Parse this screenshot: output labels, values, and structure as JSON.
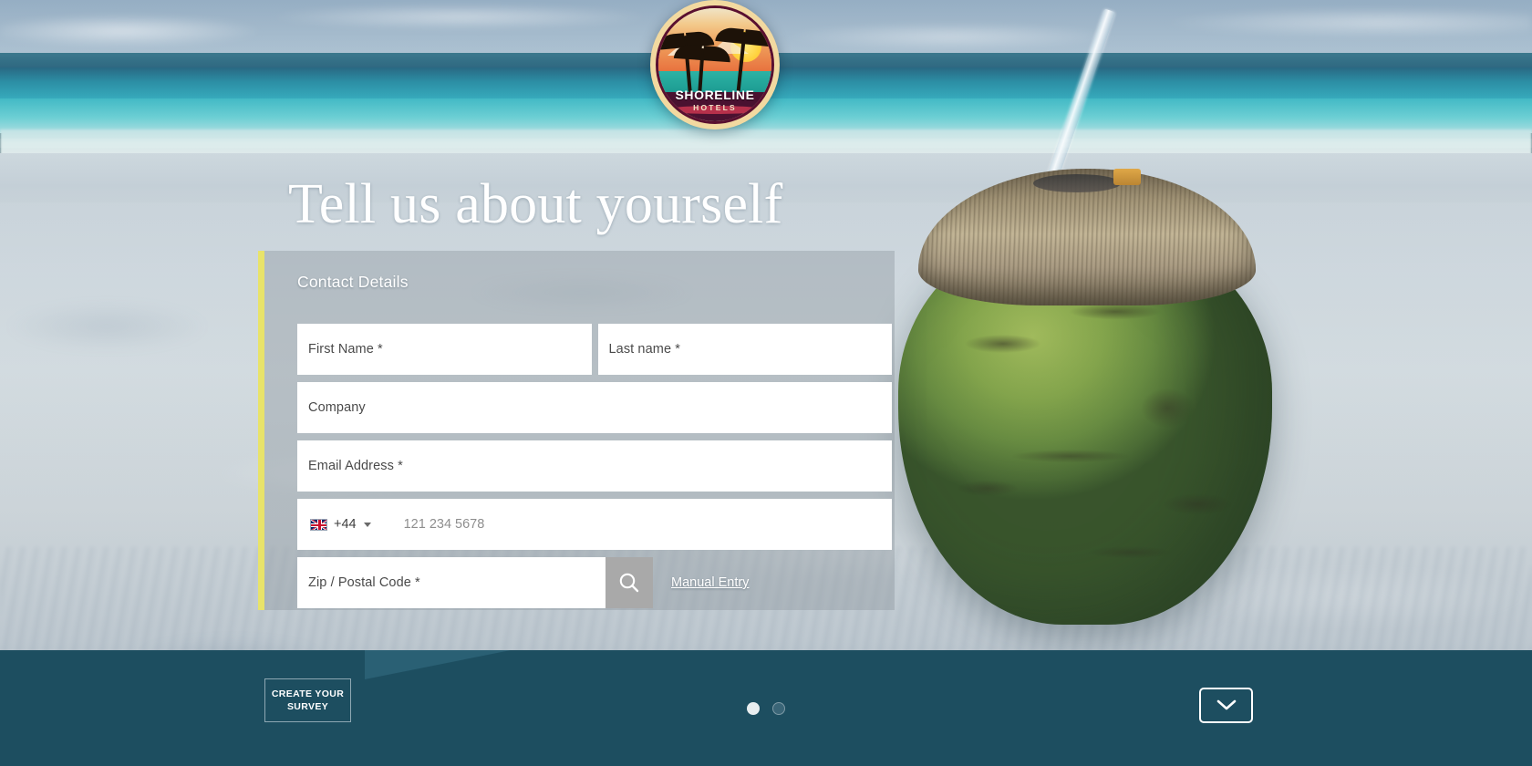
{
  "brand": {
    "name": "SHORELINE",
    "sub": "HOTELS",
    "logo_name": "shoreline-hotels-logo"
  },
  "page": {
    "title": "Tell us about yourself"
  },
  "form": {
    "section_heading": "Contact Details",
    "accent_color": "#e8e36a",
    "fields": {
      "first_name": "First Name *",
      "last_name": "Last name *",
      "company": "Company",
      "email": "Email Address *",
      "zip": "Zip / Postal Code *"
    },
    "phone": {
      "flag": "uk-flag-icon",
      "dial_code": "+44",
      "placeholder": "121 234 5678"
    },
    "zip_search_icon": "search-icon",
    "manual_entry_link": "Manual Entry"
  },
  "footer": {
    "cta_label": "CREATE YOUR SURVEY",
    "background_color": "#1d4e60",
    "pagination": {
      "total": 2,
      "active_index": 0
    },
    "scroll_icon": "chevron-down-icon"
  }
}
